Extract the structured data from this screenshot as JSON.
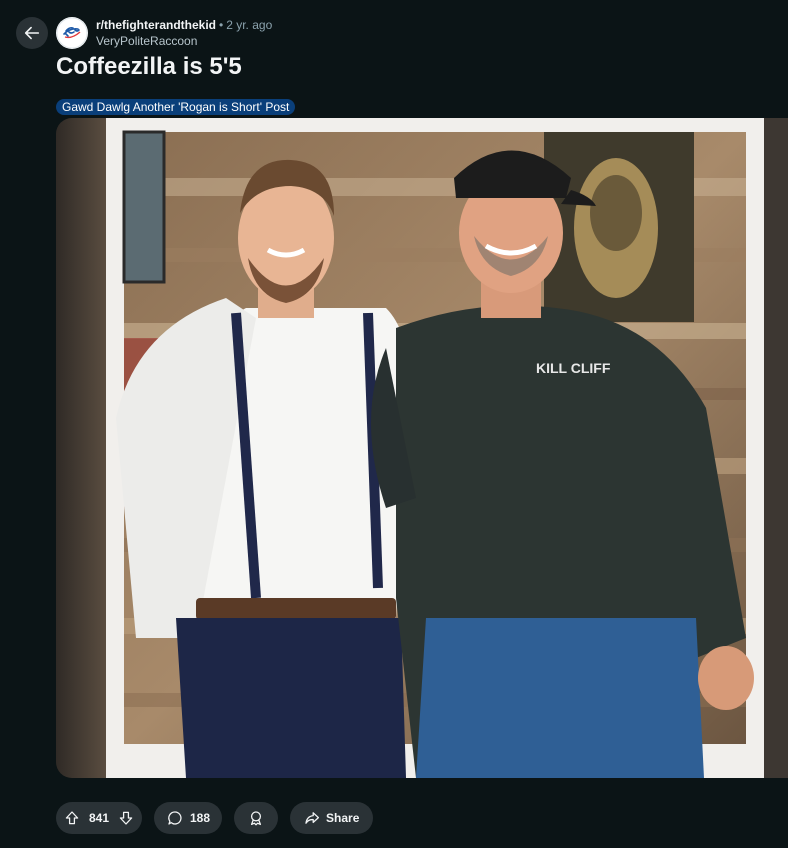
{
  "post": {
    "subreddit": "r/thefighterandthekid",
    "separator": "•",
    "age": "2 yr. ago",
    "author": "VeryPoliteRaccoon",
    "title": "Coffeezilla is 5'5",
    "flair": "Gawd Dawlg Another 'Rogan is Short' Post",
    "flair_color": "#0a3f7a",
    "avatar_logo_text": "Dodgers"
  },
  "actions": {
    "upvotes": "841",
    "comments": "188",
    "share_label": "Share"
  },
  "media": {
    "shirt_logo_text": "KILL CLIFF"
  },
  "icons": {
    "back": "arrow-left-icon",
    "upvote": "arrow-up-icon",
    "downvote": "arrow-down-icon",
    "comment": "speech-bubble-icon",
    "award": "award-ribbon-icon",
    "share": "share-arrow-icon"
  },
  "colors": {
    "background": "#0b1416",
    "button_bg": "#2a3236",
    "text": "#f2f4f5",
    "muted": "#8ba2ad"
  }
}
